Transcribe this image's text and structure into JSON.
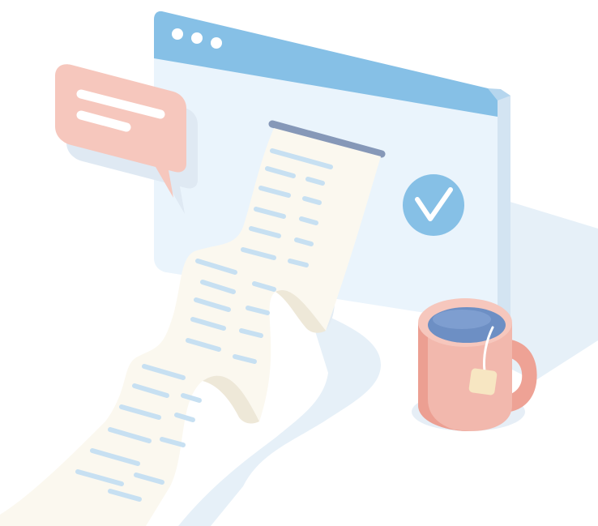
{
  "illustration": {
    "icons": {
      "window": "browser-window-icon",
      "chat": "speech-bubble-icon",
      "check": "checkmark-icon",
      "receipt": "receipt-icon",
      "mug": "tea-mug-icon"
    },
    "colors": {
      "window_bar": "#86c0e6",
      "window_body": "#eaf4fc",
      "window_side": "#d3e4f2",
      "check_badge": "#86c0e6",
      "bubble": "#f6c7bd",
      "receipt": "#fbf8ef",
      "receipt_lines": "#c7e0f2",
      "mug": "#f2b8ad",
      "tea": "#6d8fc4",
      "shadow": "#ddeaf5"
    }
  }
}
